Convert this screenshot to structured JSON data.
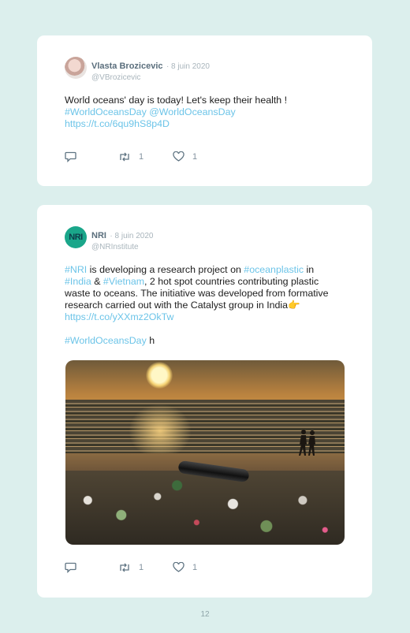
{
  "tweets": [
    {
      "name": "Vlasta Brozicevic",
      "date": "· 8 juin 2020",
      "handle": "@VBrozicevic",
      "text_main": "World oceans' day is today! Let's keep their health !",
      "links": [
        "#WorldOceansDay",
        "@WorldOceansDay",
        "https://t.co/6qu9hS8p4D"
      ],
      "retweets": "1",
      "likes": "1"
    },
    {
      "avatar_text": "NRI",
      "name": "NRI",
      "date": "· 8 juin 2020",
      "handle": "@NRInstitute",
      "parts": {
        "tag_nri": "#NRI",
        "t1": " is developing a research project on ",
        "tag_ocean": "#oceanplastic",
        "t2": " in ",
        "tag_india": "#India",
        "t3": " & ",
        "tag_vietnam": "#Vietnam",
        "t4": ", 2 hot spot countries contributing plastic waste to oceans. The initiative was developed from formative research carried out with the Catalyst group in India",
        "emoji": "👉",
        "link": "https://t.co/yXXmz2OkTw",
        "tag_wod": "#WorldOceansDay",
        "t5": " h"
      },
      "retweets": "1",
      "likes": "1"
    }
  ],
  "page_number": "12",
  "colors": {
    "link": "#6cc4e8",
    "background": "#dcefed",
    "card": "#ffffff"
  },
  "icons": [
    "reply-icon",
    "retweet-icon",
    "like-icon"
  ]
}
